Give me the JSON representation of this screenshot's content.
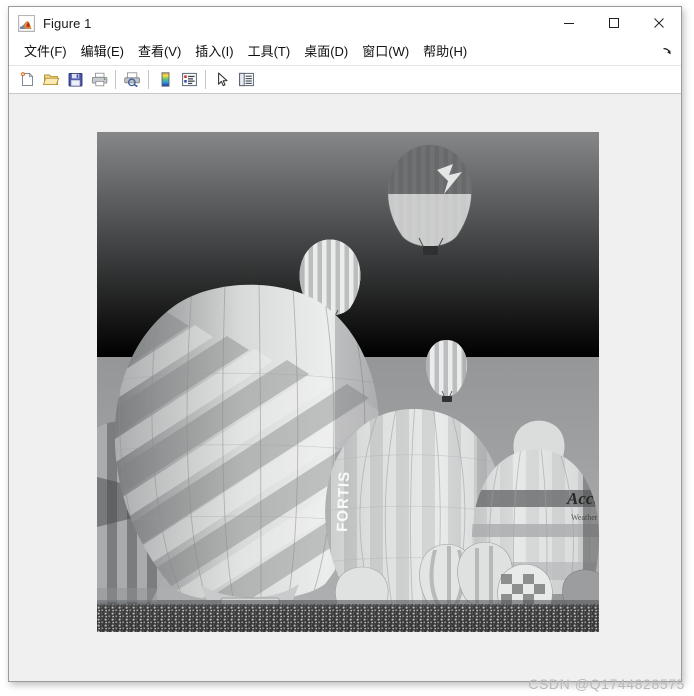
{
  "window": {
    "title": "Figure 1",
    "app_icon": "matlab-membrane-icon",
    "controls": [
      {
        "name": "minimize-button",
        "glyph": "minimize-icon",
        "label": "–"
      },
      {
        "name": "maximize-button",
        "glyph": "maximize-icon",
        "label": "□"
      },
      {
        "name": "close-button",
        "glyph": "close-icon",
        "label": "✕"
      }
    ]
  },
  "menubar": {
    "items": [
      {
        "label": "文件(F)",
        "name": "menu-file"
      },
      {
        "label": "编辑(E)",
        "name": "menu-edit"
      },
      {
        "label": "查看(V)",
        "name": "menu-view"
      },
      {
        "label": "插入(I)",
        "name": "menu-insert"
      },
      {
        "label": "工具(T)",
        "name": "menu-tools"
      },
      {
        "label": "桌面(D)",
        "name": "menu-desktop"
      },
      {
        "label": "窗口(W)",
        "name": "menu-window"
      },
      {
        "label": "帮助(H)",
        "name": "menu-help"
      }
    ],
    "overflow_icon": "overflow-arrow-icon"
  },
  "toolbar": {
    "buttons": [
      {
        "name": "new-figure-button",
        "icon": "new-figure-icon",
        "tooltip": "New Figure"
      },
      {
        "name": "open-file-button",
        "icon": "open-folder-icon",
        "tooltip": "Open File"
      },
      {
        "name": "save-figure-button",
        "icon": "save-floppy-icon",
        "tooltip": "Save Figure"
      },
      {
        "name": "print-figure-button",
        "icon": "printer-icon",
        "tooltip": "Print Figure"
      },
      {
        "name": "separator-1",
        "icon": "separator",
        "tooltip": ""
      },
      {
        "name": "print-preview-button",
        "icon": "print-preview-icon",
        "tooltip": "Print Preview"
      },
      {
        "name": "separator-2",
        "icon": "separator",
        "tooltip": ""
      },
      {
        "name": "insert-colorbar-button",
        "icon": "colorbar-icon",
        "tooltip": "Insert Colorbar"
      },
      {
        "name": "insert-legend-button",
        "icon": "legend-icon",
        "tooltip": "Insert Legend"
      },
      {
        "name": "separator-3",
        "icon": "separator",
        "tooltip": ""
      },
      {
        "name": "edit-plot-button",
        "icon": "pointer-arrow-icon",
        "tooltip": "Edit Plot"
      },
      {
        "name": "property-inspector-button",
        "icon": "property-inspector-icon",
        "tooltip": "Open Property Inspector"
      }
    ]
  },
  "figure": {
    "background_color": "#f0f0f0",
    "image": {
      "name": "balloons-grayscale-image",
      "description": "Grayscale photograph of hot air balloons at a balloon festival",
      "colormap": "gray",
      "sky_top_color": "#8f9193",
      "sky_bottom_color": "#a3a5a6",
      "ground_color": "#2e2e2e"
    }
  },
  "watermark": {
    "text": "CSDN @Q1744828575",
    "color": "#b9b9b9"
  }
}
